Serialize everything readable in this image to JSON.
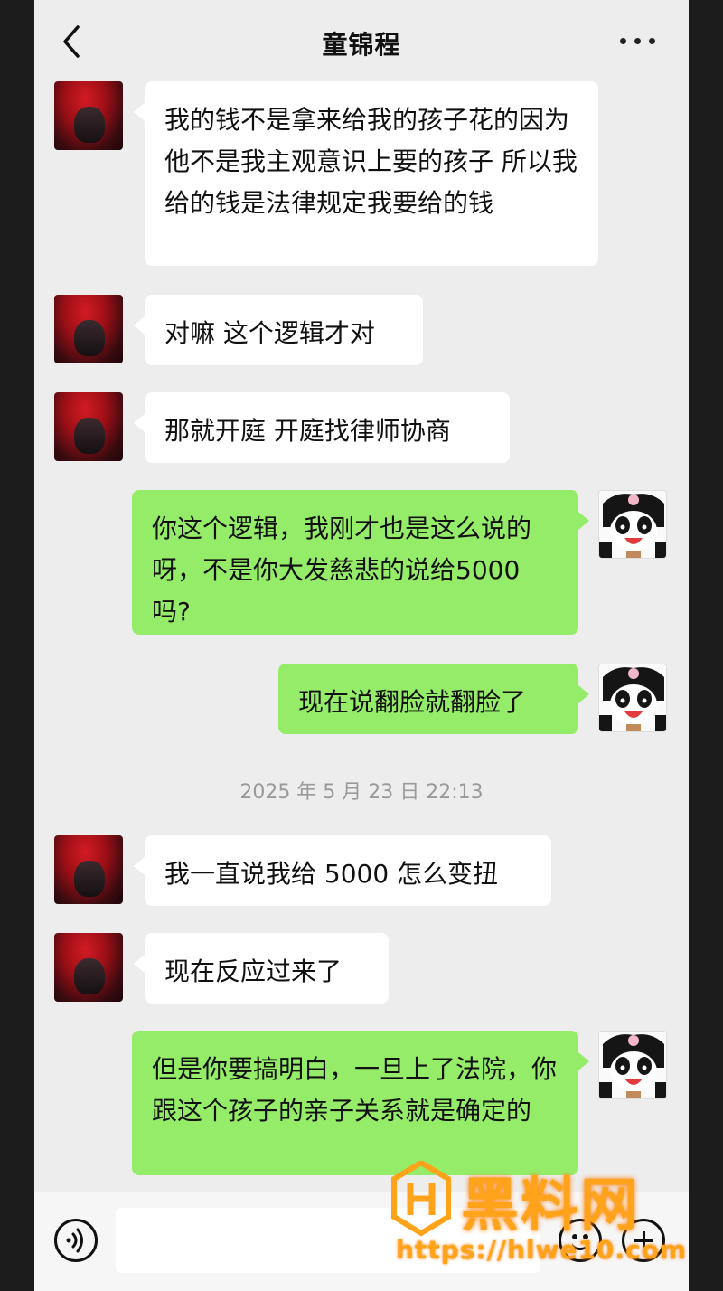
{
  "header": {
    "title": "童锦程",
    "back_icon": "chevron-left-icon",
    "more_icon": "more-dots-icon"
  },
  "messages": [
    {
      "side": "in",
      "text": "我的钱不是拿来给我的孩子花的因为他不是我主观意识上要的孩子 所以我给的钱是法律规定我要给的钱"
    },
    {
      "side": "in",
      "text": "对嘛 这个逻辑才对"
    },
    {
      "side": "in",
      "text": "那就开庭 开庭找律师协商"
    },
    {
      "side": "out",
      "text": "你这个逻辑，我刚才也是这么说的呀，不是你大发慈悲的说给5000吗?"
    },
    {
      "side": "out",
      "text": "现在说翻脸就翻脸了"
    },
    {
      "side": "in",
      "text": "我一直说我给 5000 怎么变扭"
    },
    {
      "side": "in",
      "text": "现在反应过来了"
    },
    {
      "side": "out",
      "text": "但是你要搞明白，一旦上了法院，你跟这个孩子的亲子关系就是确定的"
    }
  ],
  "timestamp": "2025 年 5 月 23 日  22:13",
  "input_bar": {
    "voice_icon": "voice-icon",
    "emoji_icon": "emoji-icon",
    "plus_icon": "plus-icon"
  },
  "watermark": {
    "name": "黑料网",
    "url": "https://hlwe10.com"
  },
  "colors": {
    "outgoing_bubble": "#95ec69",
    "incoming_bubble": "#ffffff",
    "background": "#ededed",
    "watermark": "#ffa31a"
  }
}
